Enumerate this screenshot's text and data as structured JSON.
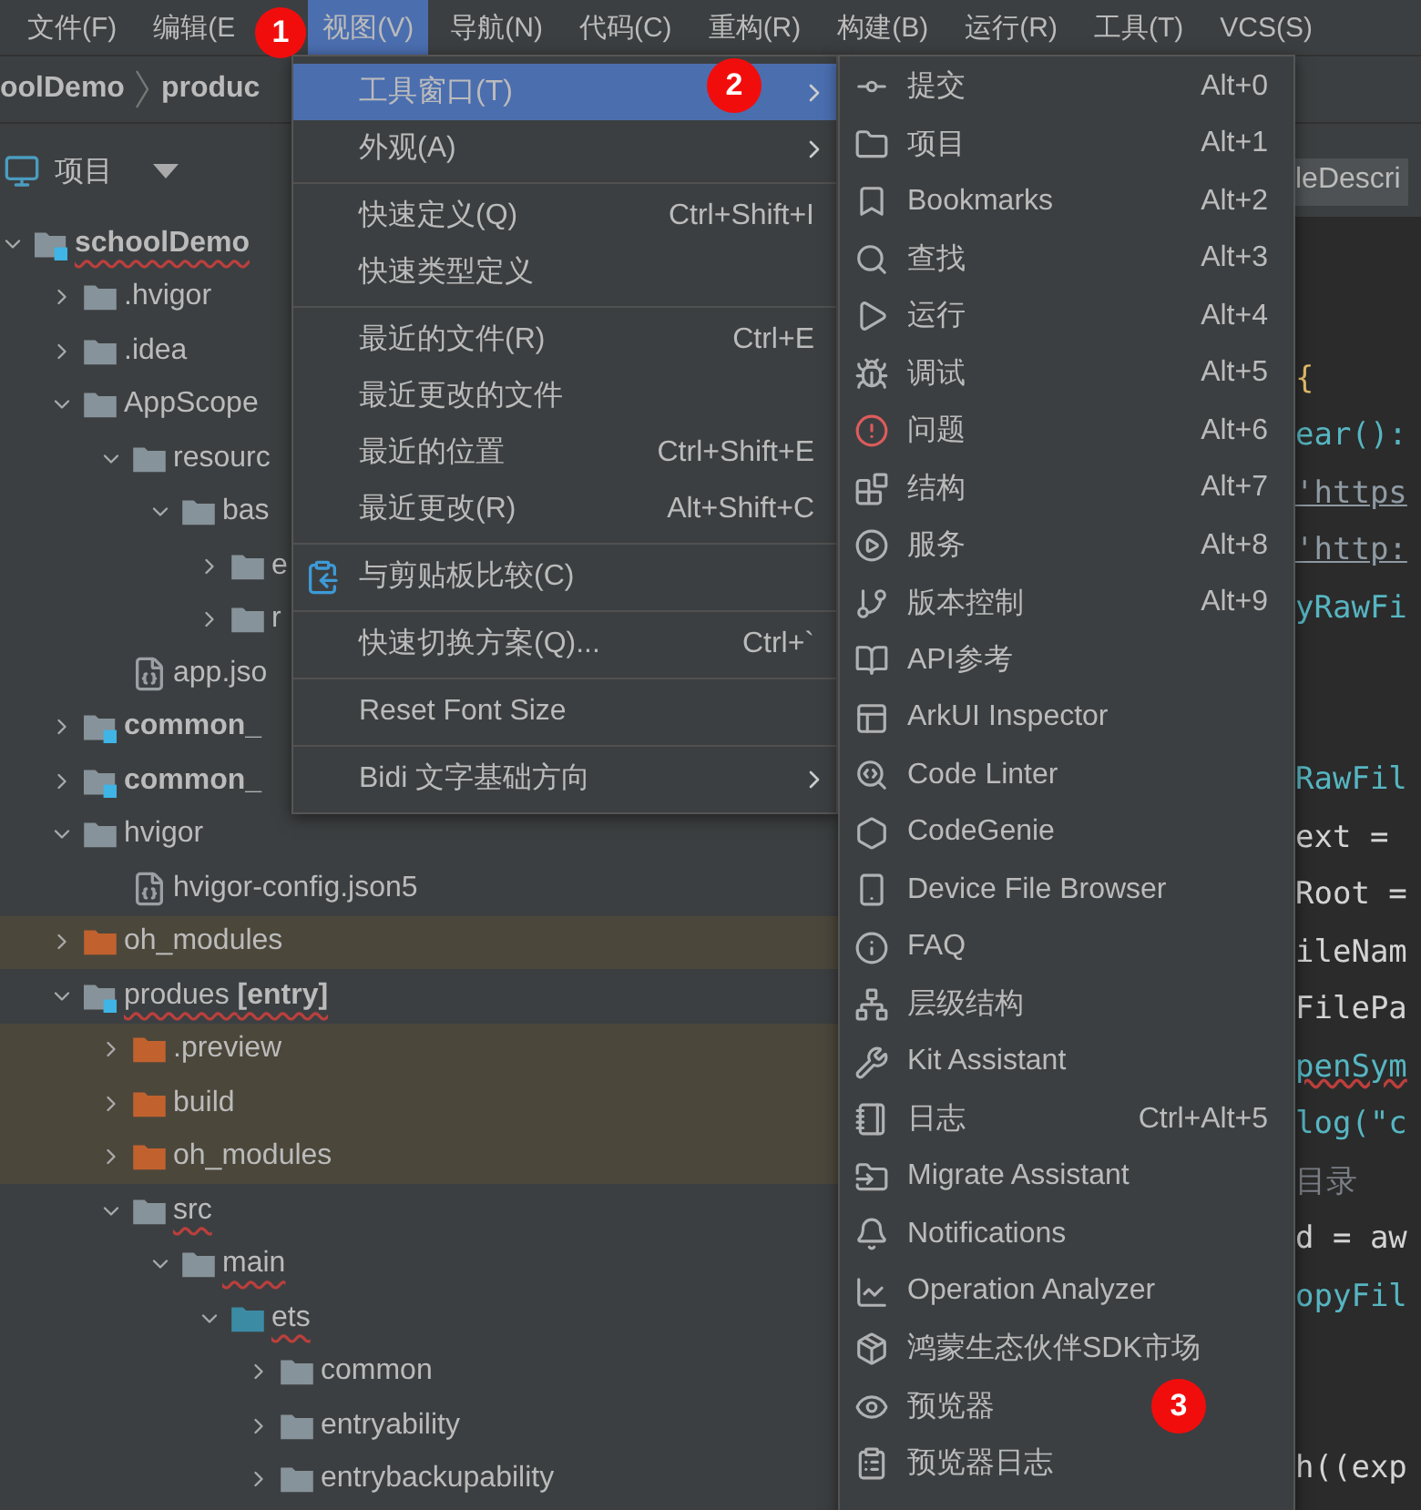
{
  "menu_bar": [
    {
      "label": "文件(F)",
      "selected": false
    },
    {
      "label": "编辑(E",
      "selected": false
    },
    {
      "label": "视图(V)",
      "selected": true
    },
    {
      "label": "导航(N)",
      "selected": false
    },
    {
      "label": "代码(C)",
      "selected": false
    },
    {
      "label": "重构(R)",
      "selected": false
    },
    {
      "label": "构建(B)",
      "selected": false
    },
    {
      "label": "运行(R)",
      "selected": false
    },
    {
      "label": "工具(T)",
      "selected": false
    },
    {
      "label": "VCS(S)",
      "selected": false
    }
  ],
  "breadcrumb": [
    "oolDemo",
    "produc"
  ],
  "project_panel": {
    "title": "项目",
    "tree": [
      {
        "label": "schoolDemo",
        "kind": "module",
        "expanded": true,
        "spell_error": true,
        "children": [
          {
            "label": ".hvigor",
            "kind": "folder",
            "expanded": false,
            "spell_error": false
          },
          {
            "label": ".idea",
            "kind": "folder",
            "expanded": false,
            "spell_error": false
          },
          {
            "label": "AppScope",
            "kind": "folder",
            "expanded": true,
            "spell_error": false,
            "children": [
              {
                "label": "resourc",
                "kind": "folder",
                "expanded": true,
                "spell_error": false,
                "children": [
                  {
                    "label": "bas",
                    "kind": "folder",
                    "expanded": true,
                    "spell_error": false,
                    "children": [
                      {
                        "label": "e",
                        "kind": "folder",
                        "expanded": false,
                        "spell_error": false
                      },
                      {
                        "label": "r",
                        "kind": "folder",
                        "expanded": false,
                        "spell_error": false
                      }
                    ]
                  }
                ]
              },
              {
                "label": "app.jso",
                "kind": "file",
                "spell_error": false
              }
            ]
          },
          {
            "label": "common_",
            "kind": "module",
            "expanded": false,
            "spell_error": false
          },
          {
            "label": "common_",
            "kind": "module",
            "expanded": false,
            "spell_error": false
          },
          {
            "label": "hvigor",
            "kind": "folder",
            "expanded": true,
            "spell_error": false,
            "children": [
              {
                "label": "hvigor-config.json5",
                "kind": "file",
                "spell_error": false
              }
            ]
          },
          {
            "label": "oh_modules",
            "kind": "excluded",
            "expanded": false,
            "spell_error": false
          },
          {
            "label": "produes **[entry]**",
            "kind": "module",
            "expanded": true,
            "spell_error": true,
            "children": [
              {
                "label": ".preview",
                "kind": "excluded",
                "expanded": false,
                "spell_error": false
              },
              {
                "label": "build",
                "kind": "excluded",
                "expanded": false,
                "spell_error": false
              },
              {
                "label": "oh_modules",
                "kind": "excluded",
                "expanded": false,
                "spell_error": false
              },
              {
                "label": "src",
                "kind": "folder",
                "expanded": true,
                "spell_error": true,
                "children": [
                  {
                    "label": "main",
                    "kind": "folder",
                    "expanded": true,
                    "spell_error": true,
                    "children": [
                      {
                        "label": "ets",
                        "kind": "source",
                        "expanded": true,
                        "spell_error": true,
                        "children": [
                          {
                            "label": "common",
                            "kind": "folder",
                            "expanded": false,
                            "spell_error": false
                          },
                          {
                            "label": "entryability",
                            "kind": "folder",
                            "expanded": false,
                            "spell_error": false
                          },
                          {
                            "label": "entrybackupability",
                            "kind": "folder",
                            "expanded": false,
                            "spell_error": false
                          }
                        ]
                      }
                    ]
                  }
                ]
              }
            ]
          }
        ]
      }
    ]
  },
  "editor": {
    "tab": "leDescri",
    "lines": [
      {
        "kind": "blank"
      },
      {
        "kind": "blank"
      },
      {
        "text": "{",
        "kind": "brace"
      },
      {
        "text": "ear():",
        "kind": "ident"
      },
      {
        "text": "'https",
        "kind": "link"
      },
      {
        "text": "'http:",
        "kind": "link"
      },
      {
        "text": "yRawFi",
        "kind": "ident"
      },
      {
        "kind": "blank"
      },
      {
        "kind": "blank"
      },
      {
        "text": "RawFil",
        "kind": "ident"
      },
      {
        "text": "ext =",
        "kind": "plain"
      },
      {
        "text": "Root =",
        "kind": "plain"
      },
      {
        "text": "ileNam",
        "kind": "plain"
      },
      {
        "text": "FilePa",
        "kind": "plain"
      },
      {
        "text": "penSym",
        "kind": "error"
      },
      {
        "text": "log(\"c",
        "kind": "ident"
      },
      {
        "text": "目录",
        "kind": "comment"
      },
      {
        "text": "d = aw",
        "kind": "plain"
      },
      {
        "text": "opyFil",
        "kind": "ident"
      },
      {
        "kind": "blank"
      },
      {
        "kind": "blank"
      },
      {
        "text": "h((exp",
        "kind": "plain"
      }
    ]
  },
  "view_menu": [
    {
      "kind": "item",
      "label": "工具窗口(T)",
      "submenu": true,
      "selected": true
    },
    {
      "kind": "item",
      "label": "外观(A)",
      "submenu": true,
      "selected": false
    },
    {
      "kind": "separator"
    },
    {
      "kind": "item",
      "label": "快速定义(Q)",
      "shortcut": "Ctrl+Shift+I",
      "submenu": false,
      "selected": false
    },
    {
      "kind": "item",
      "label": "快速类型定义",
      "submenu": false,
      "selected": false
    },
    {
      "kind": "separator"
    },
    {
      "kind": "item",
      "label": "最近的文件(R)",
      "shortcut": "Ctrl+E",
      "submenu": false,
      "selected": false
    },
    {
      "kind": "item",
      "label": "最近更改的文件",
      "submenu": false,
      "selected": false
    },
    {
      "kind": "item",
      "label": "最近的位置",
      "shortcut": "Ctrl+Shift+E",
      "submenu": false,
      "selected": false
    },
    {
      "kind": "item",
      "label": "最近更改(R)",
      "shortcut": "Alt+Shift+C",
      "submenu": false,
      "selected": false
    },
    {
      "kind": "separator"
    },
    {
      "kind": "item",
      "label": "与剪贴板比较(C)",
      "submenu": false,
      "selected": false
    },
    {
      "kind": "separator"
    },
    {
      "kind": "item",
      "label": "快速切换方案(Q)...",
      "shortcut": "Ctrl+`",
      "submenu": false,
      "selected": false
    },
    {
      "kind": "separator"
    },
    {
      "kind": "item",
      "label": "Reset Font Size",
      "submenu": false,
      "selected": false
    },
    {
      "kind": "separator"
    },
    {
      "kind": "item",
      "label": "Bidi 文字基础方向",
      "submenu": true,
      "selected": false
    }
  ],
  "tool_windows_menu": [
    {
      "label": "提交",
      "shortcut": "Alt+0"
    },
    {
      "label": "项目",
      "shortcut": "Alt+1"
    },
    {
      "label": "Bookmarks",
      "shortcut": "Alt+2"
    },
    {
      "label": "查找",
      "shortcut": "Alt+3"
    },
    {
      "label": "运行",
      "shortcut": "Alt+4"
    },
    {
      "label": "调试",
      "shortcut": "Alt+5"
    },
    {
      "label": "问题",
      "shortcut": "Alt+6"
    },
    {
      "label": "结构",
      "shortcut": "Alt+7"
    },
    {
      "label": "服务",
      "shortcut": "Alt+8"
    },
    {
      "label": "版本控制",
      "shortcut": "Alt+9"
    },
    {
      "label": "API参考"
    },
    {
      "label": "ArkUI Inspector"
    },
    {
      "label": "Code Linter"
    },
    {
      "label": "CodeGenie"
    },
    {
      "label": "Device File Browser"
    },
    {
      "label": "FAQ"
    },
    {
      "label": "层级结构"
    },
    {
      "label": "Kit Assistant"
    },
    {
      "label": "日志",
      "shortcut": "Ctrl+Alt+5"
    },
    {
      "label": "Migrate Assistant"
    },
    {
      "label": "Notifications"
    },
    {
      "label": "Operation Analyzer"
    },
    {
      "label": "鸿蒙生态伙伴SDK市场"
    },
    {
      "label": "预览器"
    },
    {
      "label": "预览器日志"
    }
  ],
  "annotations": [
    {
      "label": "1"
    },
    {
      "label": "2"
    },
    {
      "label": "3"
    }
  ]
}
